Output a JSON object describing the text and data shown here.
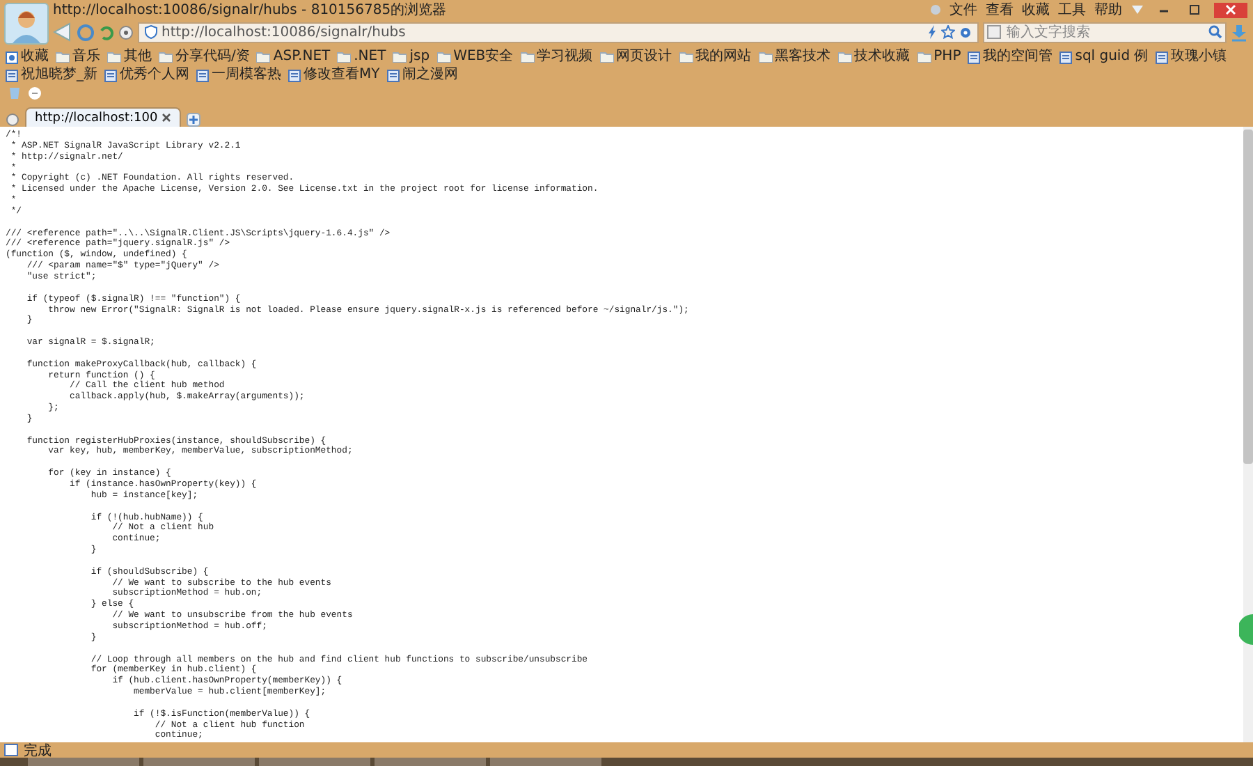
{
  "window": {
    "title": "http://localhost:10086/signalr/hubs - 810156785的浏览器"
  },
  "menu": [
    "文件",
    "查看",
    "收藏",
    "工具",
    "帮助"
  ],
  "address_bar": {
    "url": "http://localhost:10086/signalr/hubs"
  },
  "search": {
    "placeholder": "输入文字搜索"
  },
  "bookmarks": [
    {
      "label": "收藏",
      "kind": "star"
    },
    {
      "label": "音乐",
      "kind": "folder"
    },
    {
      "label": "其他",
      "kind": "folder"
    },
    {
      "label": "分享代码/资",
      "kind": "folder"
    },
    {
      "label": "ASP.NET",
      "kind": "folder"
    },
    {
      "label": ".NET",
      "kind": "folder"
    },
    {
      "label": "jsp",
      "kind": "folder"
    },
    {
      "label": "WEB安全",
      "kind": "folder"
    },
    {
      "label": "学习视频",
      "kind": "folder"
    },
    {
      "label": "网页设计",
      "kind": "folder"
    },
    {
      "label": "我的网站",
      "kind": "folder"
    },
    {
      "label": "黑客技术",
      "kind": "folder"
    },
    {
      "label": "技术收藏",
      "kind": "folder"
    },
    {
      "label": "PHP",
      "kind": "folder"
    },
    {
      "label": "我的空间管",
      "kind": "link"
    },
    {
      "label": "sql guid 例",
      "kind": "link"
    },
    {
      "label": "玫瑰小镇",
      "kind": "link"
    },
    {
      "label": "祝旭晓梦_新",
      "kind": "link"
    },
    {
      "label": "优秀个人网",
      "kind": "link"
    },
    {
      "label": "一周模客热",
      "kind": "link"
    },
    {
      "label": "修改查看MY",
      "kind": "link"
    },
    {
      "label": "闹之漫网",
      "kind": "link"
    }
  ],
  "tabs": [
    {
      "label": "http://localhost:100",
      "selected": true
    }
  ],
  "source_text": "/*!\n * ASP.NET SignalR JavaScript Library v2.2.1\n * http://signalr.net/\n *\n * Copyright (c) .NET Foundation. All rights reserved.\n * Licensed under the Apache License, Version 2.0. See License.txt in the project root for license information.\n *\n */\n\n/// <reference path=\"..\\..\\SignalR.Client.JS\\Scripts\\jquery-1.6.4.js\" />\n/// <reference path=\"jquery.signalR.js\" />\n(function ($, window, undefined) {\n    /// <param name=\"$\" type=\"jQuery\" />\n    \"use strict\";\n\n    if (typeof ($.signalR) !== \"function\") {\n        throw new Error(\"SignalR: SignalR is not loaded. Please ensure jquery.signalR-x.js is referenced before ~/signalr/js.\");\n    }\n\n    var signalR = $.signalR;\n\n    function makeProxyCallback(hub, callback) {\n        return function () {\n            // Call the client hub method\n            callback.apply(hub, $.makeArray(arguments));\n        };\n    }\n\n    function registerHubProxies(instance, shouldSubscribe) {\n        var key, hub, memberKey, memberValue, subscriptionMethod;\n\n        for (key in instance) {\n            if (instance.hasOwnProperty(key)) {\n                hub = instance[key];\n\n                if (!(hub.hubName)) {\n                    // Not a client hub\n                    continue;\n                }\n\n                if (shouldSubscribe) {\n                    // We want to subscribe to the hub events\n                    subscriptionMethod = hub.on;\n                } else {\n                    // We want to unsubscribe from the hub events\n                    subscriptionMethod = hub.off;\n                }\n\n                // Loop through all members on the hub and find client hub functions to subscribe/unsubscribe\n                for (memberKey in hub.client) {\n                    if (hub.client.hasOwnProperty(memberKey)) {\n                        memberValue = hub.client[memberKey];\n\n                        if (!$.isFunction(memberValue)) {\n                            // Not a client hub function\n                            continue;",
  "status_bar": {
    "text": "完成"
  }
}
